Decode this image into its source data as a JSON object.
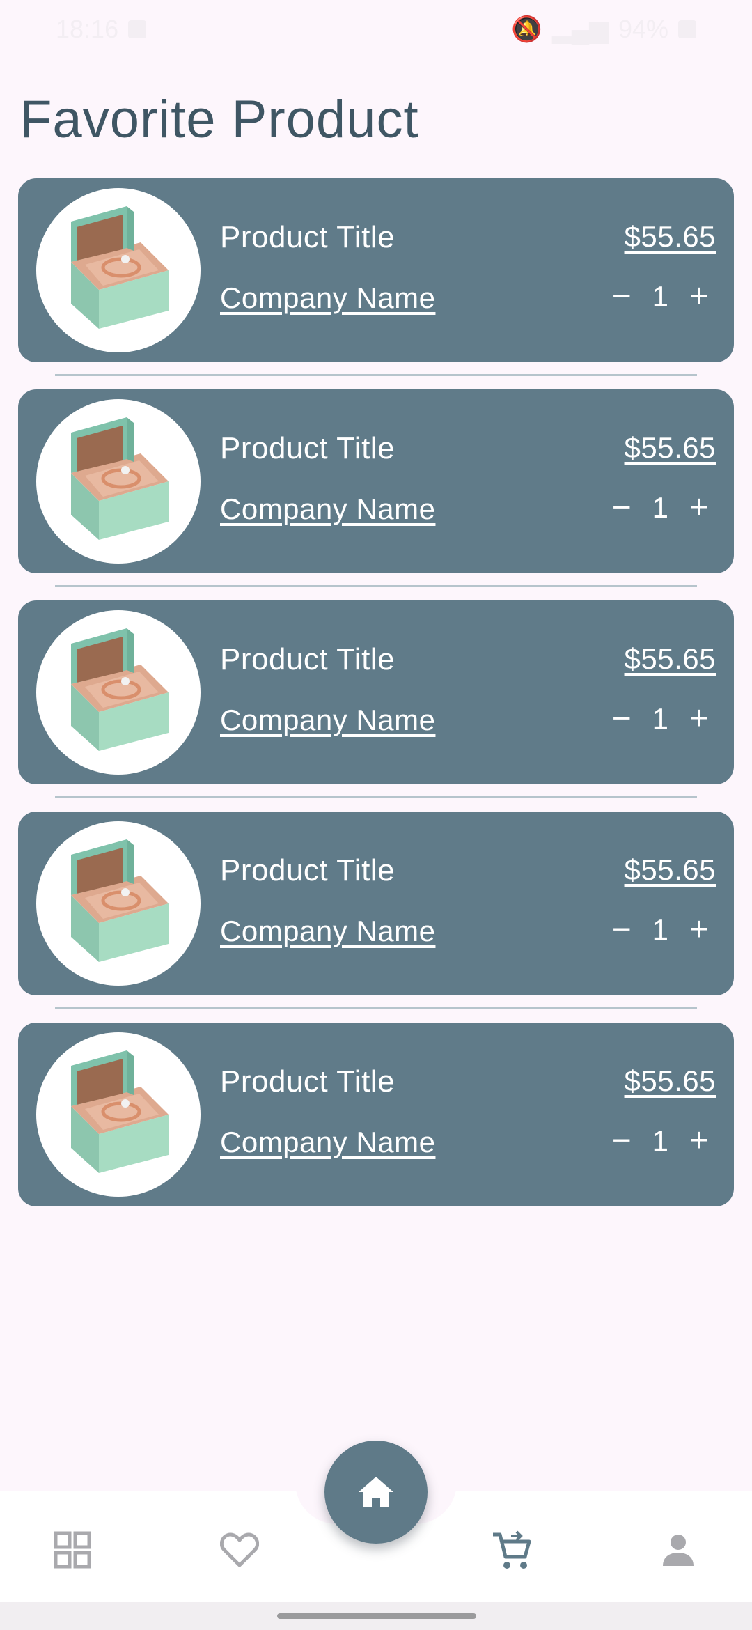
{
  "status_bar": {
    "time": "18:16",
    "battery": "94%"
  },
  "page": {
    "title": "Favorite Product"
  },
  "products": [
    {
      "title": "Product Title",
      "company": "Company Name",
      "price": "$55.65",
      "quantity": "1",
      "minus": "−",
      "plus": "+"
    },
    {
      "title": "Product Title",
      "company": "Company Name",
      "price": "$55.65",
      "quantity": "1",
      "minus": "−",
      "plus": "+"
    },
    {
      "title": "Product Title",
      "company": "Company Name",
      "price": "$55.65",
      "quantity": "1",
      "minus": "−",
      "plus": "+"
    },
    {
      "title": "Product Title",
      "company": "Company Name",
      "price": "$55.65",
      "quantity": "1",
      "minus": "−",
      "plus": "+"
    },
    {
      "title": "Product Title",
      "company": "Company Name",
      "price": "$55.65",
      "quantity": "1",
      "minus": "−",
      "plus": "+"
    }
  ],
  "bottom_nav": {
    "items": [
      {
        "icon": "grid-icon"
      },
      {
        "icon": "heart-icon"
      },
      {
        "icon": "home-icon"
      },
      {
        "icon": "cart-icon"
      },
      {
        "icon": "person-icon"
      }
    ],
    "active_color": "#5f7a88",
    "inactive_color": "#a9a9ad"
  },
  "colors": {
    "background": "#fdf6fc",
    "card": "#607b89",
    "title": "#3f5664"
  }
}
